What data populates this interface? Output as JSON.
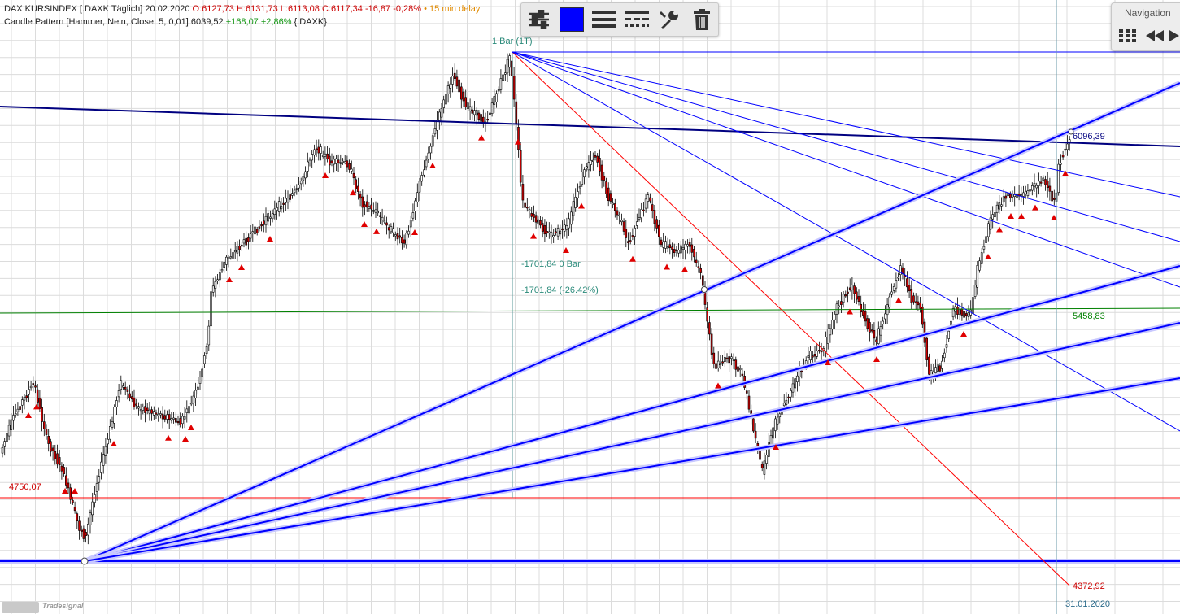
{
  "header": {
    "name": "DAX KURSINDEX [.DAXK Täglich] 20.02.2020",
    "ohlc": "O:6127,73 H:6131,73 L:6113,08 C:6117,34 -16,87 -0,28%",
    "delay": "• 15 min delay",
    "indicator_name": "Candle Pattern [Hammer, Nein, Close, 5, 0,01]",
    "indicator_value": "6039,52",
    "indicator_change": "+168,07 +2,86%",
    "indicator_symbol": "{.DAXK}"
  },
  "toolbar": {
    "buttons": [
      {
        "icon": "sliders-icon"
      },
      {
        "icon": "color-swatch-icon",
        "color": "#0000ff"
      },
      {
        "icon": "line-width-icon"
      },
      {
        "icon": "line-style-icon"
      },
      {
        "icon": "wrench-icon"
      },
      {
        "icon": "trash-icon"
      }
    ]
  },
  "navigation": {
    "title": "Navigation",
    "buttons": [
      {
        "icon": "grid-icon"
      },
      {
        "icon": "rewind-icon"
      },
      {
        "icon": "play-icon"
      }
    ]
  },
  "annotations": {
    "bar_label": "1 Bar (1T)",
    "diff_bars": "-1701,84 0 Bar",
    "diff_pct": "-1701,84 (-26.42%)",
    "value_6096": "6096,39",
    "value_5458": "5458,83",
    "value_4750": "4750,07",
    "value_4372": "4372,92",
    "date_label": "31.01.2020"
  },
  "logo": {
    "text": "Tradesignal"
  },
  "colors": {
    "background": "#ffffff",
    "grid": "#dcdcdc",
    "fan_lines": "#0000ff",
    "trend_line": "#000080",
    "support_line": "#008000",
    "red_line": "#ff0000",
    "candle_up": "#ffffff",
    "candle_down": "#cc0000",
    "marker": "#e00000"
  }
}
